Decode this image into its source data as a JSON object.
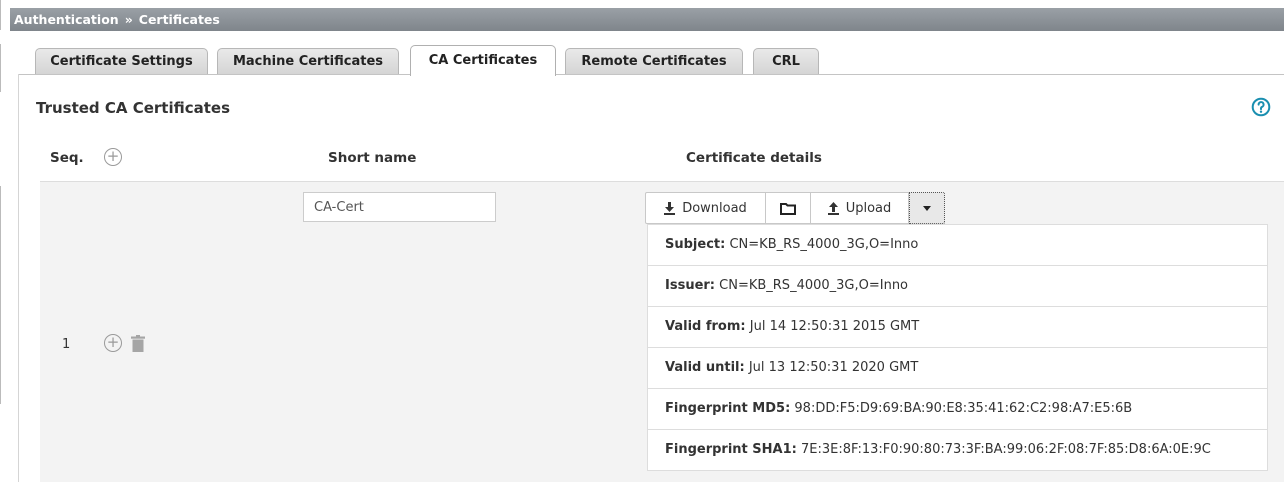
{
  "breadcrumb": {
    "parent": "Authentication",
    "separator": "»",
    "current": "Certificates"
  },
  "tabs": [
    {
      "label": "Certificate Settings",
      "active": false
    },
    {
      "label": "Machine Certificates",
      "active": false
    },
    {
      "label": "CA Certificates",
      "active": true
    },
    {
      "label": "Remote Certificates",
      "active": false
    },
    {
      "label": "CRL",
      "active": false
    }
  ],
  "section": {
    "title": "Trusted CA Certificates"
  },
  "table": {
    "headers": {
      "seq": "Seq.",
      "short_name": "Short name",
      "details": "Certificate details"
    },
    "rows": [
      {
        "seq": "1",
        "short_name": "CA-Cert",
        "buttons": {
          "download": "Download",
          "upload": "Upload"
        },
        "details": [
          {
            "label": "Subject:",
            "value": "CN=KB_RS_4000_3G,O=Inno"
          },
          {
            "label": "Issuer:",
            "value": "CN=KB_RS_4000_3G,O=Inno"
          },
          {
            "label": "Valid from:",
            "value": "Jul 14 12:50:31 2015 GMT"
          },
          {
            "label": "Valid until:",
            "value": "Jul 13 12:50:31 2020 GMT"
          },
          {
            "label": "Fingerprint MD5:",
            "value": "98:DD:F5:D9:69:BA:90:E8:35:41:62:C2:98:A7:E5:6B"
          },
          {
            "label": "Fingerprint SHA1:",
            "value": "7E:3E:8F:13:F0:90:80:73:3F:BA:99:06:2F:08:7F:85:D8:6A:0E:9C"
          }
        ]
      }
    ]
  },
  "icons": {
    "help": "question-circle-icon",
    "add": "plus-circle-icon",
    "delete": "trash-icon",
    "download": "download-icon",
    "folder": "folder-icon",
    "upload": "upload-icon",
    "dropdown": "caret-down-icon"
  },
  "colors": {
    "accent": "#1a8fb0",
    "breadcrumb_bg": "#8a9096",
    "row_bg": "#f3f3f3"
  }
}
